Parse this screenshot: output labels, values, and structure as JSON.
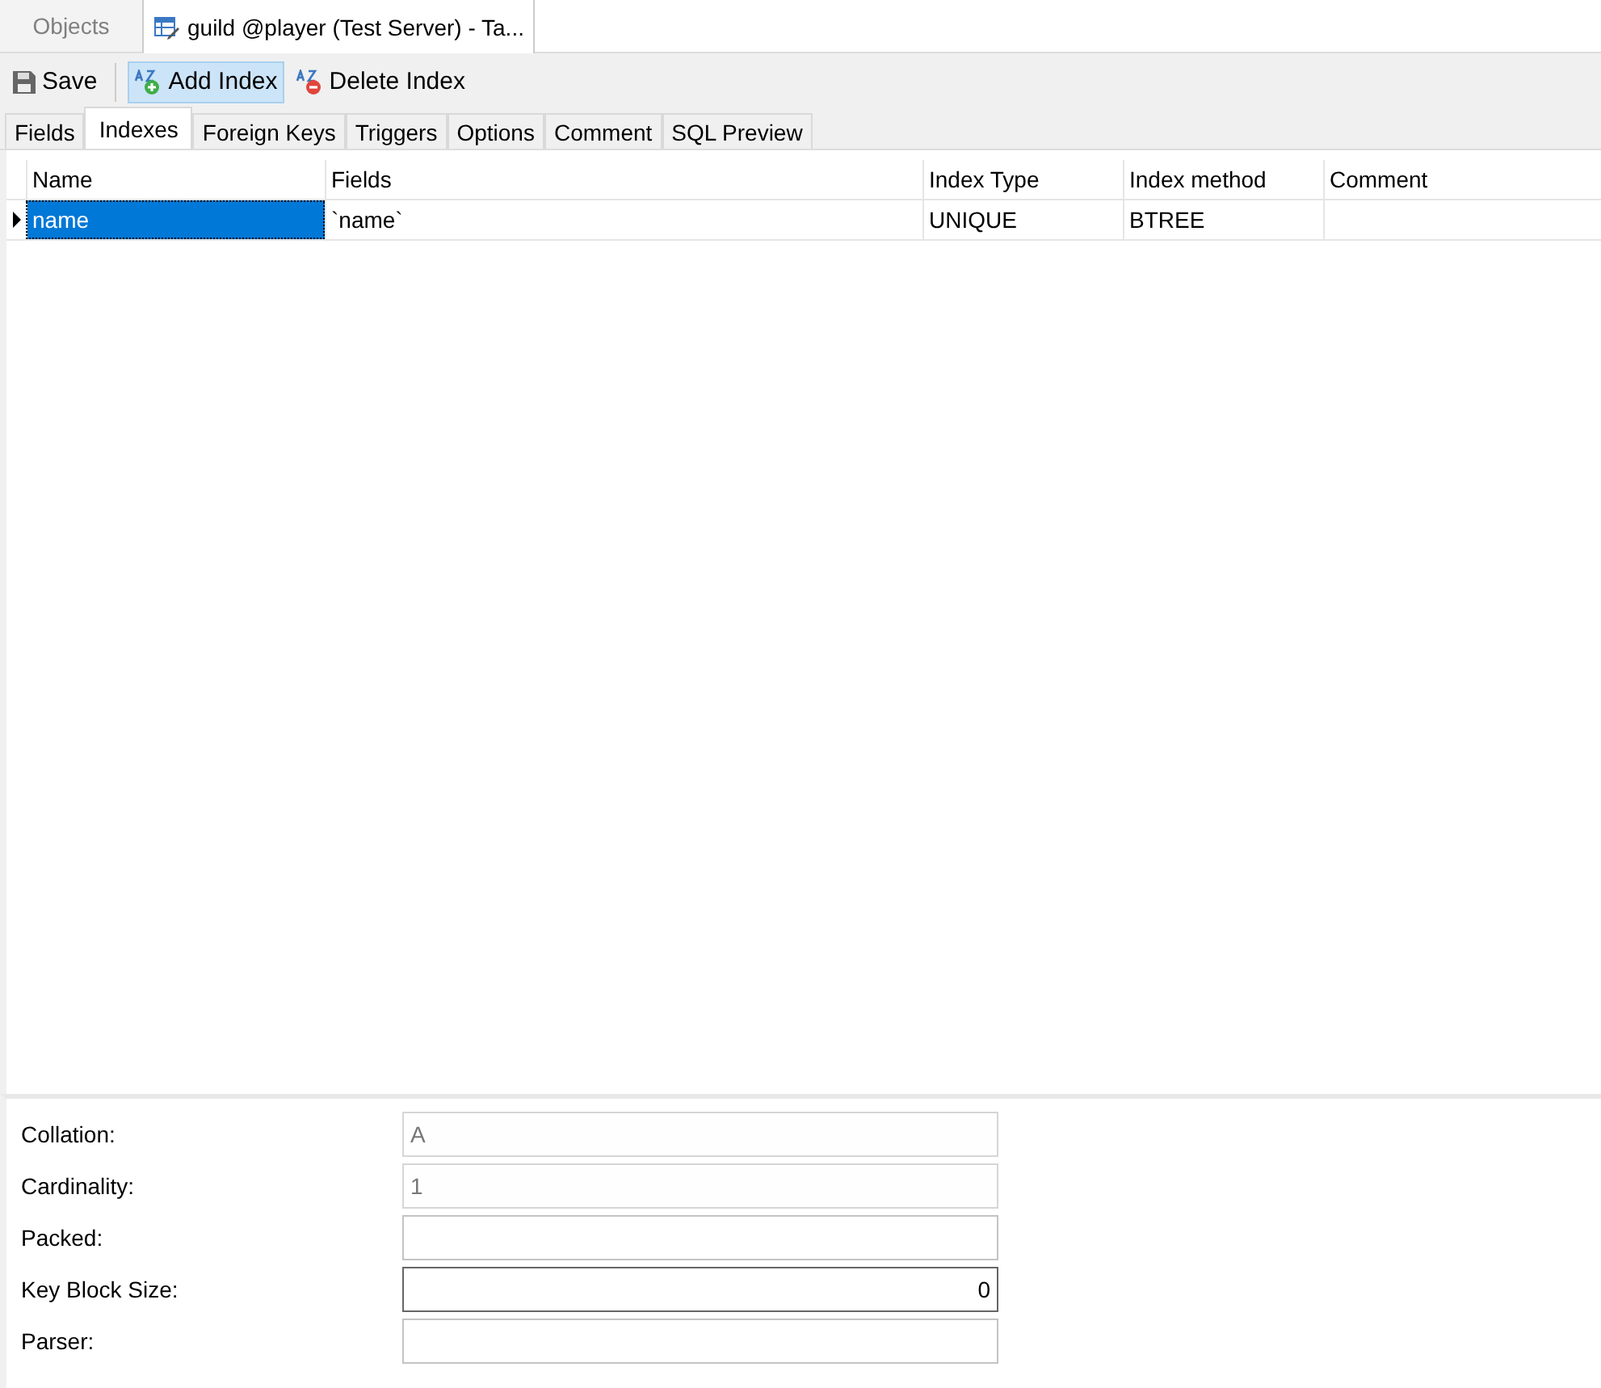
{
  "window_tabs": [
    {
      "label": "Objects",
      "selected": false,
      "kind": "objects"
    },
    {
      "label": "guild @player (Test Server) - Ta...",
      "selected": true,
      "kind": "table"
    }
  ],
  "toolbar": [
    {
      "label": "Save",
      "kind": "save",
      "hovered": false
    },
    {
      "label": "Add Index",
      "kind": "add",
      "hovered": true
    },
    {
      "label": "Delete Index",
      "kind": "delete",
      "hovered": false
    }
  ],
  "tabs": [
    {
      "label": "Fields",
      "selected": false
    },
    {
      "label": "Indexes",
      "selected": true
    },
    {
      "label": "Foreign Keys",
      "selected": false
    },
    {
      "label": "Triggers",
      "selected": false
    },
    {
      "label": "Options",
      "selected": false
    },
    {
      "label": "Comment",
      "selected": false
    },
    {
      "label": "SQL Preview",
      "selected": false
    }
  ],
  "table": {
    "columns": [
      "Name",
      "Fields",
      "Index Type",
      "Index method",
      "Comment"
    ],
    "rows": [
      {
        "selected": true,
        "cells": [
          "name",
          "`name`",
          "UNIQUE",
          "BTREE",
          ""
        ]
      }
    ]
  },
  "properties": [
    {
      "label": "Collation:",
      "value": "A",
      "disabled": true,
      "focused": false,
      "kind": "text"
    },
    {
      "label": "Cardinality:",
      "value": "1",
      "disabled": true,
      "focused": false,
      "kind": "text"
    },
    {
      "label": "Packed:",
      "disabled": false,
      "focused": false,
      "kind": "text"
    },
    {
      "label": "Key Block Size:",
      "value": "0",
      "disabled": false,
      "focused": true,
      "kind": "number"
    },
    {
      "label": "Parser:",
      "disabled": false,
      "focused": false,
      "kind": "text"
    }
  ]
}
